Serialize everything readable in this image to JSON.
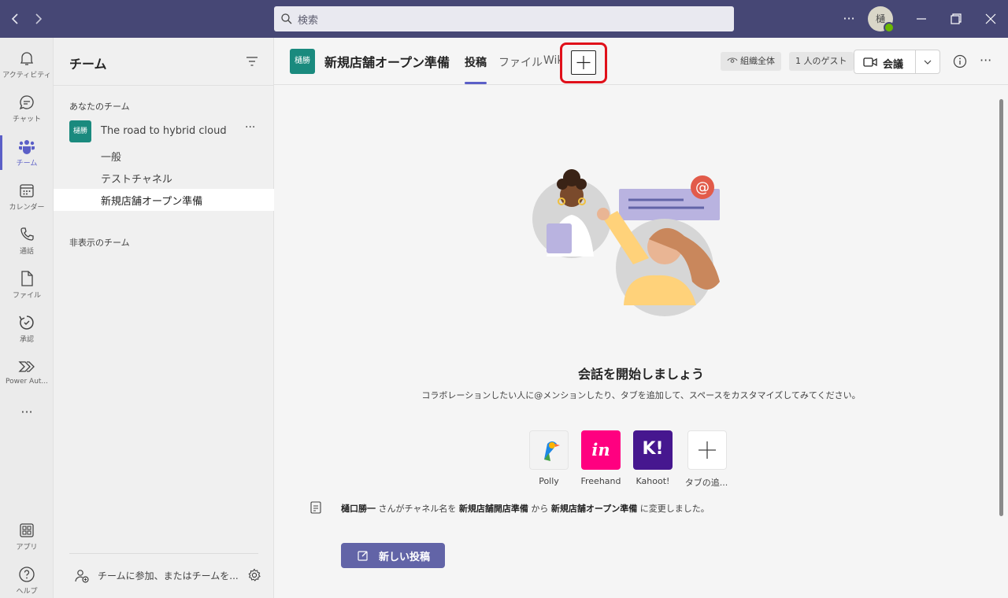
{
  "titlebar": {
    "back_icon": "chevron-left-icon",
    "forward_icon": "chevron-right-icon",
    "search_placeholder": "検索",
    "more_label": "···",
    "avatar_initial": "樋",
    "window_controls": {
      "minimize": "—",
      "restore": "❐",
      "close": "✕"
    }
  },
  "rail": {
    "items": [
      {
        "label": "アクティビティ",
        "icon": "bell-icon"
      },
      {
        "label": "チャット",
        "icon": "chat-icon"
      },
      {
        "label": "チーム",
        "icon": "teams-icon",
        "active": true
      },
      {
        "label": "カレンダー",
        "icon": "calendar-icon"
      },
      {
        "label": "通話",
        "icon": "phone-icon"
      },
      {
        "label": "ファイル",
        "icon": "file-icon"
      },
      {
        "label": "承認",
        "icon": "approvals-icon"
      },
      {
        "label": "Power Aut...",
        "icon": "power-automate-icon"
      }
    ],
    "more": "···",
    "bottom": [
      {
        "label": "アプリ",
        "icon": "apps-icon"
      },
      {
        "label": "ヘルプ",
        "icon": "help-icon"
      }
    ]
  },
  "teams_panel": {
    "title": "チーム",
    "your_teams_label": "あなたのチーム",
    "team": {
      "avatar": "樋勝",
      "name": "The road to hybrid cloud",
      "more": "···"
    },
    "channels": [
      "一般",
      "テストチャネル",
      "新規店舗オープン準備"
    ],
    "hidden_teams_label": "非表示のチーム",
    "join_label": "チームに参加、またはチームを..."
  },
  "channel_header": {
    "avatar": "樋勝",
    "title": "新規店舗オープン準備",
    "tabs": [
      "投稿",
      "ファイル",
      "Wiki"
    ],
    "add_tab": "+",
    "org_wide": "組織全体",
    "guests": "1 人のゲスト",
    "meet_label": "会議"
  },
  "empty_state": {
    "title": "会話を開始しましょう",
    "subtitle": "コラボレーションしたい人に@メンションしたり、タブを追加して、スペースをカスタマイズしてみてください。"
  },
  "apps": [
    {
      "name": "Polly",
      "icon": "polly-icon",
      "color": "#f3f3f3"
    },
    {
      "name": "Freehand",
      "icon": "freehand-icon",
      "color": "#ff0080",
      "glyph": "in"
    },
    {
      "name": "Kahoot!",
      "icon": "kahoot-icon",
      "color": "#46178f",
      "glyph": "K!"
    },
    {
      "name": "タブの追...",
      "icon": "plus-icon",
      "color": "#ffffff",
      "glyph": "+"
    }
  ],
  "system_message": {
    "user": "樋口勝一",
    "text1": "さんがチャネル名を",
    "old_name": "新規店舗開店準備",
    "text2": "から",
    "new_name": "新規店舗オープン準備",
    "text3": "に変更しました。"
  },
  "new_post_label": "新しい投稿",
  "colors": {
    "titlebar": "#464775",
    "accent": "#5b5fc7",
    "team_avatar": "#1a8a7e",
    "highlight": "#e0101a"
  }
}
